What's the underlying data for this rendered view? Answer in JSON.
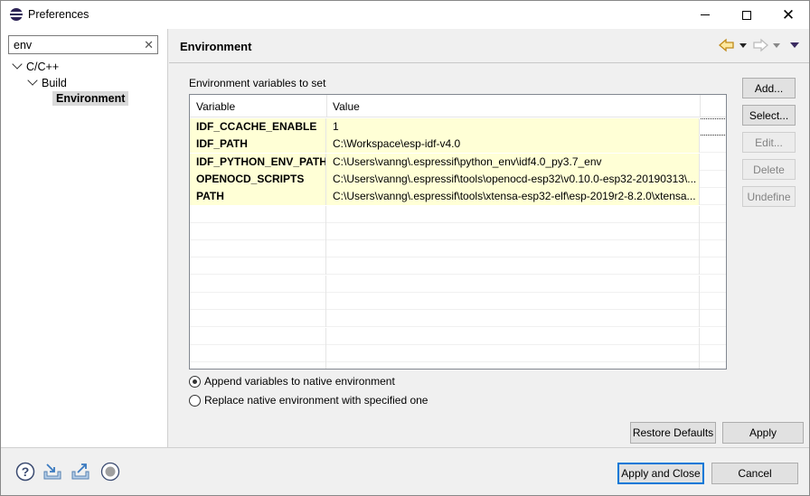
{
  "window": {
    "title": "Preferences",
    "minimize_icon": "minimize-icon",
    "maximize_icon": "maximize-icon",
    "close_icon": "close-icon"
  },
  "sidebar": {
    "search": {
      "value": "env",
      "clear_icon": "clear-icon"
    },
    "tree": [
      {
        "label": "C/C++",
        "expanded": true,
        "level": 0
      },
      {
        "label": "Build",
        "expanded": true,
        "level": 1
      },
      {
        "label": "Environment",
        "selected": true,
        "level": 2
      }
    ]
  },
  "page": {
    "title": "Environment",
    "nav_icons": [
      "back-arrow-icon",
      "back-menu-icon",
      "forward-arrow-icon",
      "forward-menu-icon",
      "view-menu-icon"
    ],
    "section_label": "Environment variables to set",
    "table": {
      "columns": [
        "Variable",
        "Value"
      ],
      "rows": [
        {
          "variable": "IDF_CCACHE_ENABLE",
          "value": "1",
          "highlight": true,
          "focused": true
        },
        {
          "variable": "IDF_PATH",
          "value": "C:\\Workspace\\esp-idf-v4.0",
          "highlight": true
        },
        {
          "variable": "IDF_PYTHON_ENV_PATH",
          "value": "C:\\Users\\vanng\\.espressif\\python_env\\idf4.0_py3.7_env",
          "highlight": true
        },
        {
          "variable": "OPENOCD_SCRIPTS",
          "value": "C:\\Users\\vanng\\.espressif\\tools\\openocd-esp32\\v0.10.0-esp32-20190313\\...",
          "highlight": true
        },
        {
          "variable": "PATH",
          "value": "C:\\Users\\vanng\\.espressif\\tools\\xtensa-esp32-elf\\esp-2019r2-8.2.0\\xtensa...",
          "highlight": true
        }
      ]
    },
    "side_buttons": [
      {
        "label": "Add...",
        "enabled": true
      },
      {
        "label": "Select...",
        "enabled": true
      },
      {
        "label": "Edit...",
        "enabled": false
      },
      {
        "label": "Delete",
        "enabled": false
      },
      {
        "label": "Undefine",
        "enabled": false
      }
    ],
    "radios": [
      {
        "label": "Append variables to native environment",
        "checked": true
      },
      {
        "label": "Replace native environment with specified one",
        "checked": false
      }
    ],
    "restore_defaults": "Restore Defaults",
    "apply": "Apply"
  },
  "footer": {
    "icons": [
      "help-icon",
      "import-icon",
      "export-icon",
      "record-icon"
    ],
    "apply_and_close": "Apply and Close",
    "cancel": "Cancel"
  },
  "colors": {
    "row_highlight": "#ffffd6",
    "default_button_border": "#0078d7",
    "selected_tree_item": "#d9d9d9"
  }
}
